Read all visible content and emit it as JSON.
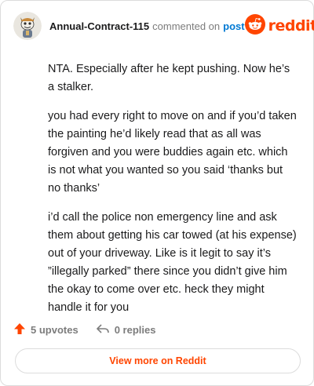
{
  "header": {
    "author": "Annual-Contract-115",
    "commented_text": "commented on",
    "post_link": "post",
    "brand": "reddit",
    "avatar_icon": "snoo-avatar-icon",
    "brand_icon": "reddit-snoo-icon",
    "brand_color": "#ff4500"
  },
  "comment": {
    "paragraphs": [
      "NTA. Especially after he kept pushing. Now he’s a stalker.",
      "you had every right to move on and if you’d taken the painting he’d likely read that as all was forgiven and you were buddies again etc. which is not what you wanted so you said ‘thanks but no thanks’",
      "i’d call the police non emergency line and ask them about getting his car towed (at his expense) out of your driveway. Like is it legit to say it’s ”illegally parked” there since you didn’t give him the okay to come over etc. heck they might handle it for you"
    ]
  },
  "actions": {
    "upvotes": "5 upvotes",
    "replies": "0 replies",
    "upvote_icon": "upvote-arrow-icon",
    "reply_icon": "reply-arrow-icon"
  },
  "footer": {
    "view_more": "View more on Reddit"
  }
}
